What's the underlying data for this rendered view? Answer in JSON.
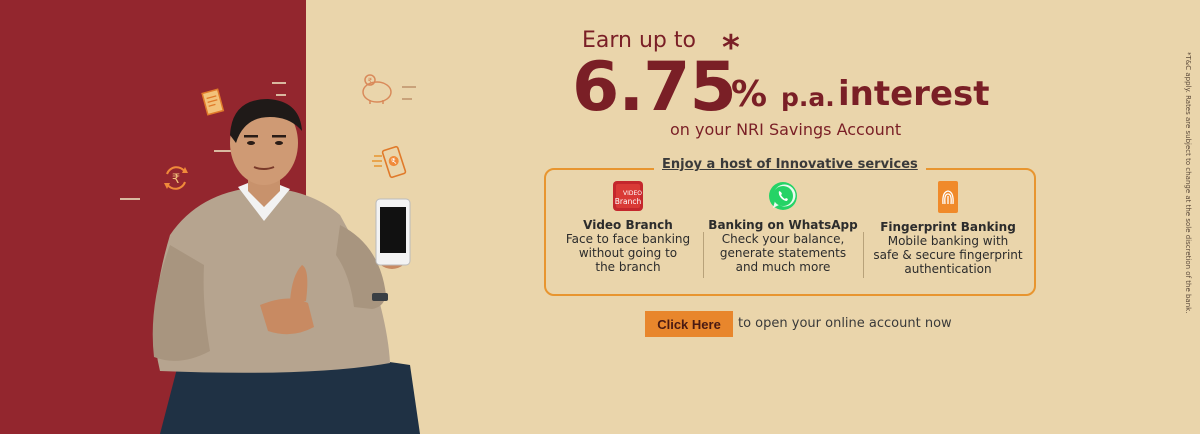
{
  "headline": {
    "earn_text": "Earn up to",
    "asterisk": "*",
    "rate": "6.75",
    "percent": "%",
    "pa": "p.a.",
    "interest": "interest",
    "subline": "on your NRI Savings Account"
  },
  "services": {
    "title": "Enjoy a host of Innovative services",
    "items": [
      {
        "icon": "video-branch-icon",
        "name": "Video Branch",
        "desc": [
          "Face to face banking",
          "without going to",
          "the branch"
        ],
        "icon_label": "VIDEO Branch"
      },
      {
        "icon": "whatsapp-icon",
        "name": "Banking on WhatsApp",
        "desc": [
          "Check your balance,",
          "generate statements",
          "and much more"
        ]
      },
      {
        "icon": "fingerprint-icon",
        "name": "Fingerprint Banking",
        "desc": [
          "Mobile banking with",
          "safe & secure fingerprint",
          "authentication"
        ]
      }
    ]
  },
  "cta": {
    "button_label": "Click Here",
    "text": "to open your online account now"
  },
  "disclaimer": "*T&C apply. Rates are subject to change at the sole discretion of the bank.",
  "colors": {
    "maroon": "#93262e",
    "beige": "#ead5ab",
    "accent_orange": "#e8862c",
    "headline": "#7a1f26"
  }
}
